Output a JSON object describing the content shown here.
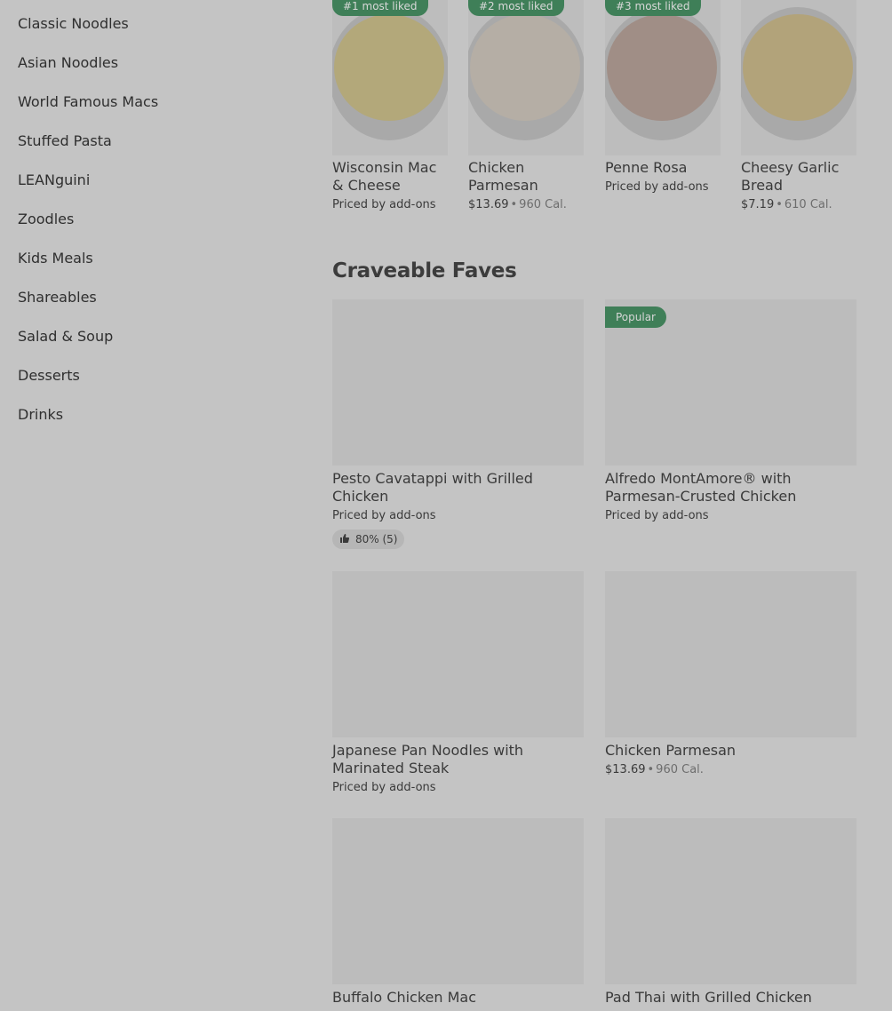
{
  "sidebar": {
    "items": [
      {
        "label": "Classic Noodles"
      },
      {
        "label": "Asian Noodles"
      },
      {
        "label": "World Famous Macs"
      },
      {
        "label": "Stuffed Pasta"
      },
      {
        "label": "LEANguini"
      },
      {
        "label": "Zoodles"
      },
      {
        "label": "Kids Meals"
      },
      {
        "label": "Shareables"
      },
      {
        "label": "Salad & Soup"
      },
      {
        "label": "Desserts"
      },
      {
        "label": "Drinks"
      }
    ]
  },
  "most_liked": [
    {
      "badge": "#1 most liked",
      "title": "Wisconsin Mac & Cheese",
      "sub": "Priced by add-ons"
    },
    {
      "badge": "#2 most liked",
      "title": "Chicken Parmesan",
      "price": "$13.69",
      "sep": "•",
      "cal": "960 Cal."
    },
    {
      "badge": "#3 most liked",
      "title": "Penne Rosa",
      "sub": "Priced by add-ons"
    },
    {
      "title": "Cheesy Garlic Bread",
      "price": "$7.19",
      "sep": "•",
      "cal": "610 Cal."
    }
  ],
  "craveable": {
    "title": "Craveable Faves",
    "items": [
      {
        "title": "Pesto Cavatappi with Grilled Chicken",
        "sub": "Priced by add-ons",
        "rating": "80% (5)"
      },
      {
        "badge": "Popular",
        "title": "Alfredo MontAmore® with Parmesan-Crusted Chicken",
        "sub": "Priced by add-ons"
      },
      {
        "title": "Japanese Pan Noodles with Marinated Steak",
        "sub": "Priced by add-ons"
      },
      {
        "title": "Chicken Parmesan",
        "price": "$13.69",
        "sep": "•",
        "cal": "960 Cal."
      },
      {
        "title": "Buffalo Chicken Mac"
      },
      {
        "title": "Pad Thai with Grilled Chicken"
      }
    ]
  },
  "colors": {
    "badge_green": "#3f7f58",
    "overlay_gray": "#c4c4c4"
  },
  "icons": {
    "rating": "thumbs-up-icon"
  }
}
